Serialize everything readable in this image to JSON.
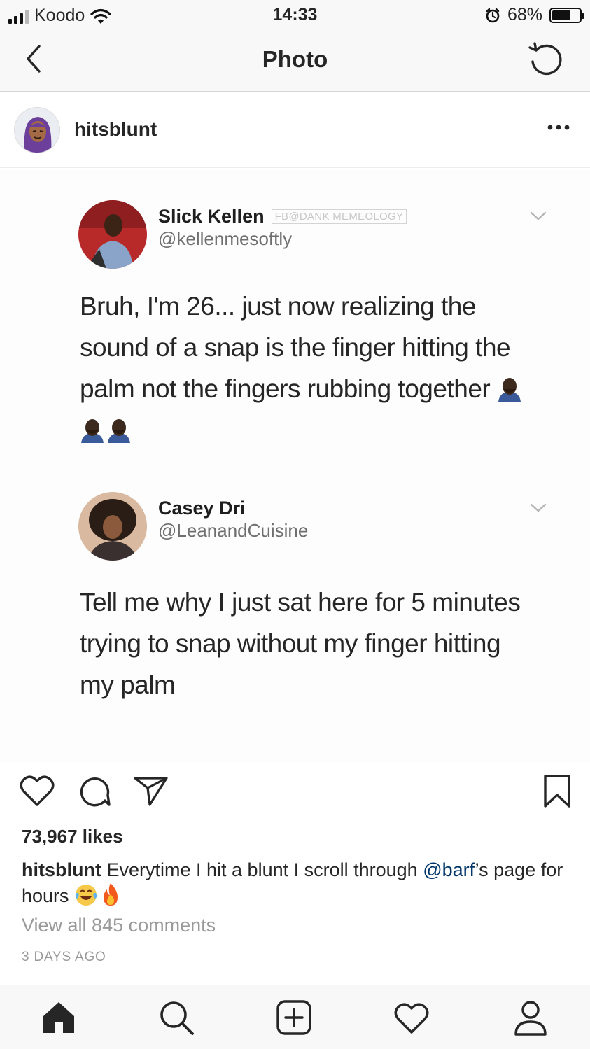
{
  "status_bar": {
    "carrier": "Koodo",
    "time": "14:33",
    "battery_percent": "68%",
    "battery_level": 0.68,
    "signal_bars": 3
  },
  "nav": {
    "title": "Photo",
    "back_icon": "chevron-left-icon",
    "refresh_icon": "refresh-icon"
  },
  "post": {
    "username": "hitsblunt",
    "more_icon": "ellipsis-icon",
    "tweets": [
      {
        "name": "Slick Kellen",
        "watermark": "FB@DANK MEMEOLOGY",
        "handle": "@kellenmesoftly",
        "text": "Bruh, I'm 26... just now realizing the sound of a snap is the finger hitting the palm not the fingers rubbing together",
        "emoji": [
          "facepalm-emoji",
          "facepalm-emoji",
          "facepalm-emoji"
        ]
      },
      {
        "name": "Casey Dri",
        "handle": "@LeanandCuisine",
        "text": "Tell me why I just sat here for 5 minutes trying to snap without my finger hitting my palm"
      }
    ],
    "likes": "73,967 likes",
    "caption": {
      "user": "hitsblunt",
      "text_before": " Everytime I hit a blunt I scroll through ",
      "mention": "@barf",
      "text_after": "’s page for hours ",
      "emoji": [
        "laughing-tears-emoji",
        "fire-emoji"
      ]
    },
    "comments_link": "View all 845 comments",
    "timestamp": "3 DAYS AGO"
  },
  "tabs": [
    "home-icon",
    "search-icon",
    "add-post-icon",
    "activity-heart-icon",
    "profile-icon"
  ],
  "colors": {
    "bar_bg": "#f8f8f8",
    "text": "#262626",
    "muted": "#999999",
    "mention": "#003569"
  }
}
